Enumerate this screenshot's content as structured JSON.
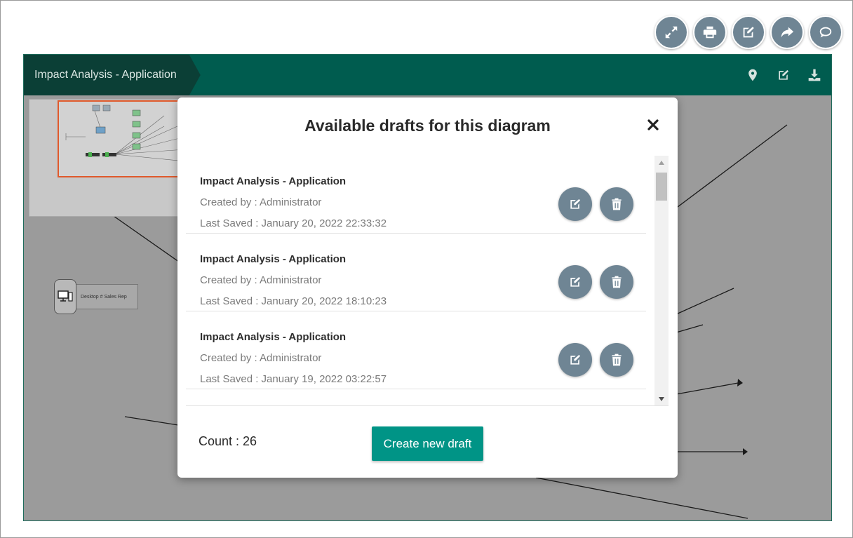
{
  "toolbar": {
    "buttons": [
      {
        "icon": "expand-icon",
        "label": "Expand"
      },
      {
        "icon": "print-icon",
        "label": "Print"
      },
      {
        "icon": "edit-icon",
        "label": "Edit"
      },
      {
        "icon": "share-icon",
        "label": "Share"
      },
      {
        "icon": "comments-icon",
        "label": "Comments"
      }
    ]
  },
  "panel": {
    "title": "Impact Analysis - Application",
    "tools": [
      "map-marker-icon",
      "edit-icon",
      "download-icon"
    ],
    "header_color": "#005c4f"
  },
  "canvas": {
    "node_label": "Desktop # Sales Rep"
  },
  "modal": {
    "title": "Available drafts for this diagram",
    "drafts": [
      {
        "name": "Impact Analysis - Application",
        "created_by": "Created by : Administrator",
        "last_saved": "Last Saved : January 20, 2022 22:33:32"
      },
      {
        "name": "Impact Analysis - Application",
        "created_by": "Created by : Administrator",
        "last_saved": "Last Saved : January 20, 2022 18:10:23"
      },
      {
        "name": "Impact Analysis - Application",
        "created_by": "Created by : Administrator",
        "last_saved": "Last Saved : January 19, 2022 03:22:57"
      }
    ],
    "count_label": "Count : 26",
    "create_button": "Create new draft",
    "accent_color": "#009486"
  }
}
